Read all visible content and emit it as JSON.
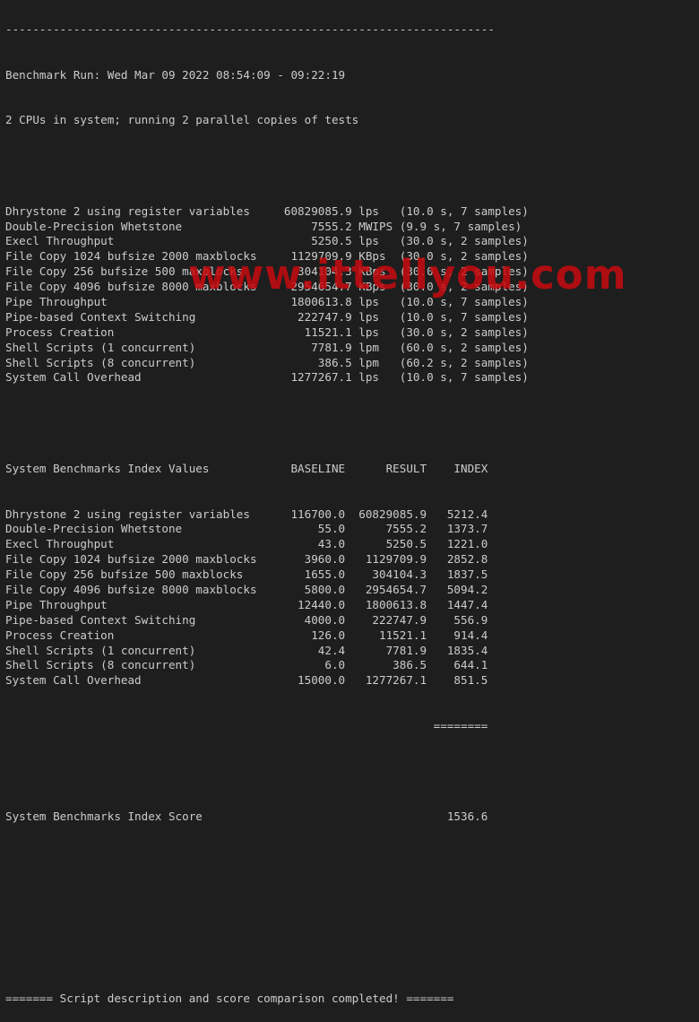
{
  "terminal": {
    "separator_top": "------------------------------------------------------------------------",
    "run_line": "Benchmark Run: Wed Mar 09 2022 08:54:09 - 09:22:19",
    "cpu_line": "2 CPUs in system; running 2 parallel copies of tests",
    "results": [
      {
        "test": "Dhrystone 2 using register variables",
        "value": "60829085.9",
        "unit": "lps",
        "detail": "(10.0 s, 7 samples)"
      },
      {
        "test": "Double-Precision Whetstone",
        "value": "7555.2",
        "unit": "MWIPS",
        "detail": "(9.9 s, 7 samples)"
      },
      {
        "test": "Execl Throughput",
        "value": "5250.5",
        "unit": "lps",
        "detail": "(30.0 s, 2 samples)"
      },
      {
        "test": "File Copy 1024 bufsize 2000 maxblocks",
        "value": "1129709.9",
        "unit": "KBps",
        "detail": "(30.0 s, 2 samples)"
      },
      {
        "test": "File Copy 256 bufsize 500 maxblocks",
        "value": "304104.3",
        "unit": "KBps",
        "detail": "(30.0 s, 2 samples)"
      },
      {
        "test": "File Copy 4096 bufsize 8000 maxblocks",
        "value": "2954654.7",
        "unit": "KBps",
        "detail": "(30.0 s, 2 samples)"
      },
      {
        "test": "Pipe Throughput",
        "value": "1800613.8",
        "unit": "lps",
        "detail": "(10.0 s, 7 samples)"
      },
      {
        "test": "Pipe-based Context Switching",
        "value": "222747.9",
        "unit": "lps",
        "detail": "(10.0 s, 7 samples)"
      },
      {
        "test": "Process Creation",
        "value": "11521.1",
        "unit": "lps",
        "detail": "(30.0 s, 2 samples)"
      },
      {
        "test": "Shell Scripts (1 concurrent)",
        "value": "7781.9",
        "unit": "lpm",
        "detail": "(60.0 s, 2 samples)"
      },
      {
        "test": "Shell Scripts (8 concurrent)",
        "value": "386.5",
        "unit": "lpm",
        "detail": "(60.2 s, 2 samples)"
      },
      {
        "test": "System Call Overhead",
        "value": "1277267.1",
        "unit": "lps",
        "detail": "(10.0 s, 7 samples)"
      }
    ],
    "index_header": {
      "title": "System Benchmarks Index Values",
      "baseline": "BASELINE",
      "result": "RESULT",
      "index": "INDEX"
    },
    "index_rows": [
      {
        "test": "Dhrystone 2 using register variables",
        "baseline": "116700.0",
        "result": "60829085.9",
        "index": "5212.4"
      },
      {
        "test": "Double-Precision Whetstone",
        "baseline": "55.0",
        "result": "7555.2",
        "index": "1373.7"
      },
      {
        "test": "Execl Throughput",
        "baseline": "43.0",
        "result": "5250.5",
        "index": "1221.0"
      },
      {
        "test": "File Copy 1024 bufsize 2000 maxblocks",
        "baseline": "3960.0",
        "result": "1129709.9",
        "index": "2852.8"
      },
      {
        "test": "File Copy 256 bufsize 500 maxblocks",
        "baseline": "1655.0",
        "result": "304104.3",
        "index": "1837.5"
      },
      {
        "test": "File Copy 4096 bufsize 8000 maxblocks",
        "baseline": "5800.0",
        "result": "2954654.7",
        "index": "5094.2"
      },
      {
        "test": "Pipe Throughput",
        "baseline": "12440.0",
        "result": "1800613.8",
        "index": "1447.4"
      },
      {
        "test": "Pipe-based Context Switching",
        "baseline": "4000.0",
        "result": "222747.9",
        "index": "556.9"
      },
      {
        "test": "Process Creation",
        "baseline": "126.0",
        "result": "11521.1",
        "index": "914.4"
      },
      {
        "test": "Shell Scripts (1 concurrent)",
        "baseline": "42.4",
        "result": "7781.9",
        "index": "1835.4"
      },
      {
        "test": "Shell Scripts (8 concurrent)",
        "baseline": "6.0",
        "result": "386.5",
        "index": "644.1"
      },
      {
        "test": "System Call Overhead",
        "baseline": "15000.0",
        "result": "1277267.1",
        "index": "851.5"
      }
    ],
    "score_rule": "========",
    "score_label": "System Benchmarks Index Score",
    "score_value": "1536.6",
    "completion_line": "======= Script description and score comparison completed! ======="
  },
  "watermark": "www.ittellyou.com",
  "colors": {
    "background": "#1e1e1e",
    "text": "#cccccc",
    "watermark": "#c80a0f"
  }
}
